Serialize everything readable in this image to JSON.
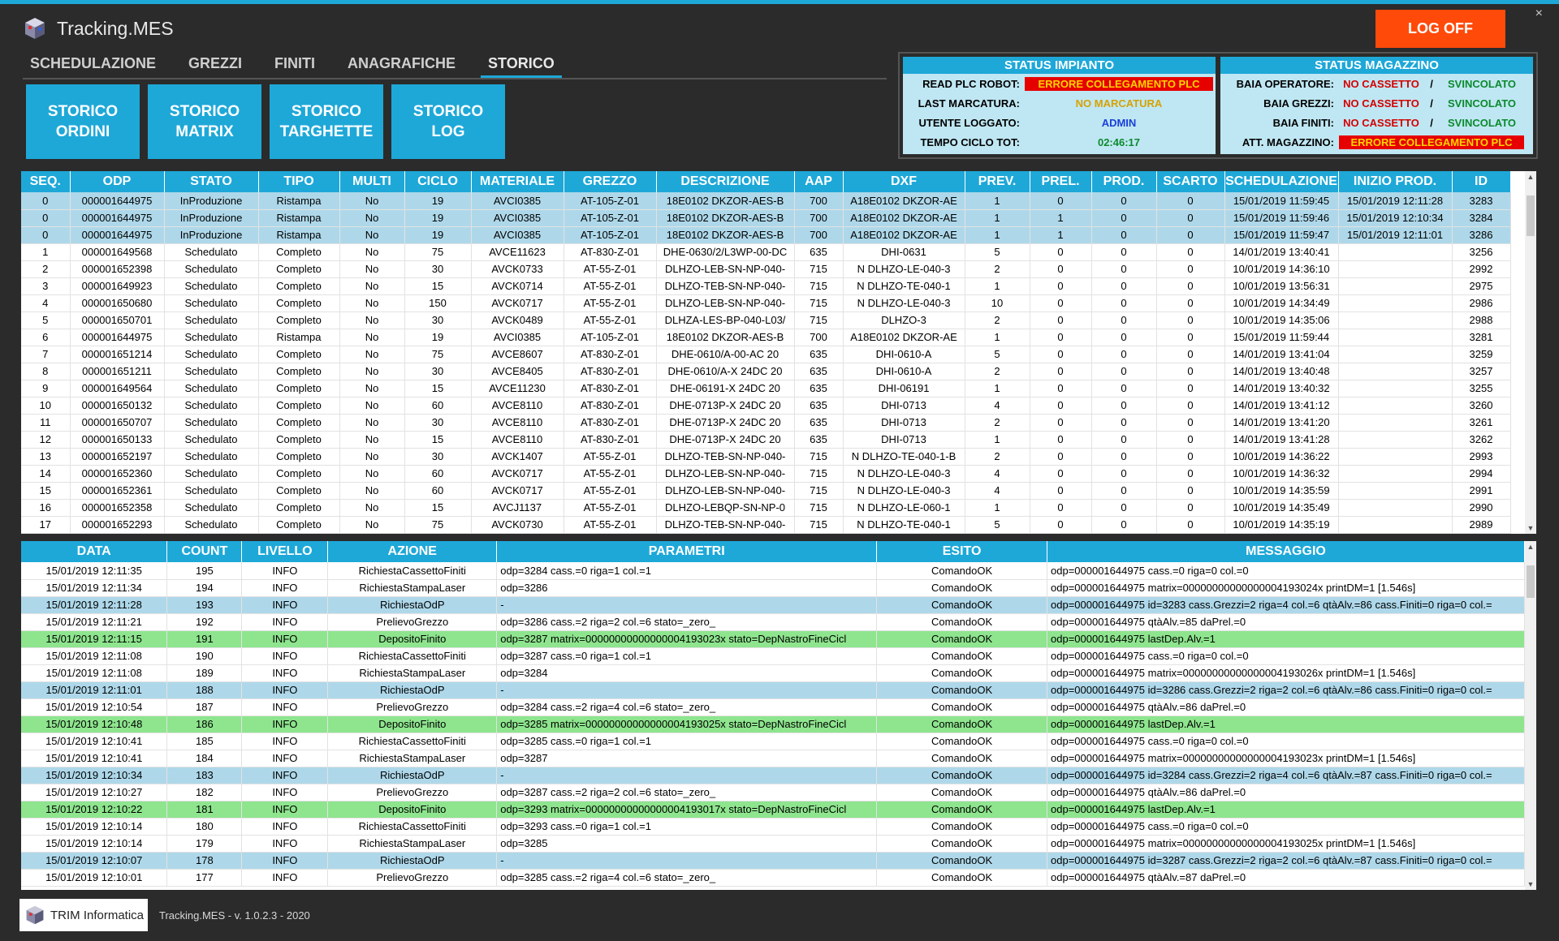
{
  "app": {
    "title": "Tracking.MES",
    "close_glyph": "×",
    "logoff_label": "LOG OFF"
  },
  "menu": [
    "SCHEDULAZIONE",
    "GREZZI",
    "FINITI",
    "ANAGRAFICHE",
    "STORICO"
  ],
  "menu_active": "STORICO",
  "subbuttons": [
    {
      "line1": "STORICO",
      "line2": "ORDINI"
    },
    {
      "line1": "STORICO",
      "line2": "MATRIX"
    },
    {
      "line1": "STORICO",
      "line2": "TARGHETTE"
    },
    {
      "line1": "STORICO",
      "line2": "LOG"
    }
  ],
  "status_impianto": {
    "title": "STATUS IMPIANTO",
    "rows": [
      {
        "label": "READ PLC ROBOT:",
        "value": "ERRORE COLLEGAMENTO PLC",
        "style": "err"
      },
      {
        "label": "LAST MARCATURA:",
        "value": "NO MARCATURA",
        "style": "warn"
      },
      {
        "label": "UTENTE LOGGATO:",
        "value": "ADMIN",
        "style": "blue"
      },
      {
        "label": "TEMPO CICLO TOT:",
        "value": "02:46:17",
        "style": "green"
      }
    ]
  },
  "status_magazzino": {
    "title": "STATUS MAGAZZINO",
    "rows": [
      {
        "label": "BAIA OPERATORE:",
        "left": "NO CASSETTO",
        "sep": "/",
        "right": "SVINCOLATO"
      },
      {
        "label": "BAIA GREZZI:",
        "left": "NO CASSETTO",
        "sep": "/",
        "right": "SVINCOLATO"
      },
      {
        "label": "BAIA FINITI:",
        "left": "NO CASSETTO",
        "sep": "/",
        "right": "SVINCOLATO"
      }
    ],
    "att_label": "ATT. MAGAZZINO:",
    "att_value": "ERRORE COLLEGAMENTO PLC"
  },
  "orders": {
    "columns": [
      "SEQ.",
      "ODP",
      "STATO",
      "TIPO",
      "MULTI",
      "CICLO",
      "MATERIALE",
      "GREZZO",
      "DESCRIZIONE",
      "AAP",
      "DXF",
      "PREV.",
      "PREL.",
      "PROD.",
      "SCARTO",
      "SCHEDULAZIONE",
      "INIZIO PROD.",
      "ID"
    ],
    "rows": [
      [
        "0",
        "000001644975",
        "InProduzione",
        "Ristampa",
        "No",
        "19",
        "AVCI0385",
        "AT-105-Z-01",
        "18E0102 DKZOR-AES-B",
        "700",
        "A18E0102 DKZOR-AE",
        "1",
        "0",
        "0",
        "0",
        "15/01/2019 11:59:45",
        "15/01/2019 12:11:28",
        "3283"
      ],
      [
        "0",
        "000001644975",
        "InProduzione",
        "Ristampa",
        "No",
        "19",
        "AVCI0385",
        "AT-105-Z-01",
        "18E0102 DKZOR-AES-B",
        "700",
        "A18E0102 DKZOR-AE",
        "1",
        "1",
        "0",
        "0",
        "15/01/2019 11:59:46",
        "15/01/2019 12:10:34",
        "3284"
      ],
      [
        "0",
        "000001644975",
        "InProduzione",
        "Ristampa",
        "No",
        "19",
        "AVCI0385",
        "AT-105-Z-01",
        "18E0102 DKZOR-AES-B",
        "700",
        "A18E0102 DKZOR-AE",
        "1",
        "1",
        "0",
        "0",
        "15/01/2019 11:59:47",
        "15/01/2019 12:11:01",
        "3286"
      ],
      [
        "1",
        "000001649568",
        "Schedulato",
        "Completo",
        "No",
        "75",
        "AVCE11623",
        "AT-830-Z-01",
        "DHE-0630/2/L3WP-00-DC",
        "635",
        "DHI-0631",
        "5",
        "0",
        "0",
        "0",
        "14/01/2019 13:40:41",
        "",
        "3256"
      ],
      [
        "2",
        "000001652398",
        "Schedulato",
        "Completo",
        "No",
        "30",
        "AVCK0733",
        "AT-55-Z-01",
        "DLHZO-LEB-SN-NP-040-",
        "715",
        "N DLHZO-LE-040-3",
        "2",
        "0",
        "0",
        "0",
        "10/01/2019 14:36:10",
        "",
        "2992"
      ],
      [
        "3",
        "000001649923",
        "Schedulato",
        "Completo",
        "No",
        "15",
        "AVCK0714",
        "AT-55-Z-01",
        "DLHZO-TEB-SN-NP-040-",
        "715",
        "N DLHZO-TE-040-1",
        "1",
        "0",
        "0",
        "0",
        "10/01/2019 13:56:31",
        "",
        "2975"
      ],
      [
        "4",
        "000001650680",
        "Schedulato",
        "Completo",
        "No",
        "150",
        "AVCK0717",
        "AT-55-Z-01",
        "DLHZO-LEB-SN-NP-040-",
        "715",
        "N DLHZO-LE-040-3",
        "10",
        "0",
        "0",
        "0",
        "10/01/2019 14:34:49",
        "",
        "2986"
      ],
      [
        "5",
        "000001650701",
        "Schedulato",
        "Completo",
        "No",
        "30",
        "AVCK0489",
        "AT-55-Z-01",
        "DLHZA-LES-BP-040-L03/",
        "715",
        "DLHZO-3",
        "2",
        "0",
        "0",
        "0",
        "10/01/2019 14:35:06",
        "",
        "2988"
      ],
      [
        "6",
        "000001644975",
        "Schedulato",
        "Ristampa",
        "No",
        "19",
        "AVCI0385",
        "AT-105-Z-01",
        "18E0102 DKZOR-AES-B",
        "700",
        "A18E0102 DKZOR-AE",
        "1",
        "0",
        "0",
        "0",
        "15/01/2019 11:59:44",
        "",
        "3281"
      ],
      [
        "7",
        "000001651214",
        "Schedulato",
        "Completo",
        "No",
        "75",
        "AVCE8607",
        "AT-830-Z-01",
        "DHE-0610/A-00-AC 20",
        "635",
        "DHI-0610-A",
        "5",
        "0",
        "0",
        "0",
        "14/01/2019 13:41:04",
        "",
        "3259"
      ],
      [
        "8",
        "000001651211",
        "Schedulato",
        "Completo",
        "No",
        "30",
        "AVCE8405",
        "AT-830-Z-01",
        "DHE-0610/A-X 24DC 20",
        "635",
        "DHI-0610-A",
        "2",
        "0",
        "0",
        "0",
        "14/01/2019 13:40:48",
        "",
        "3257"
      ],
      [
        "9",
        "000001649564",
        "Schedulato",
        "Completo",
        "No",
        "15",
        "AVCE11230",
        "AT-830-Z-01",
        "DHE-06191-X 24DC 20",
        "635",
        "DHI-06191",
        "1",
        "0",
        "0",
        "0",
        "14/01/2019 13:40:32",
        "",
        "3255"
      ],
      [
        "10",
        "000001650132",
        "Schedulato",
        "Completo",
        "No",
        "60",
        "AVCE8110",
        "AT-830-Z-01",
        "DHE-0713P-X 24DC 20",
        "635",
        "DHI-0713",
        "4",
        "0",
        "0",
        "0",
        "14/01/2019 13:41:12",
        "",
        "3260"
      ],
      [
        "11",
        "000001650707",
        "Schedulato",
        "Completo",
        "No",
        "30",
        "AVCE8110",
        "AT-830-Z-01",
        "DHE-0713P-X 24DC 20",
        "635",
        "DHI-0713",
        "2",
        "0",
        "0",
        "0",
        "14/01/2019 13:41:20",
        "",
        "3261"
      ],
      [
        "12",
        "000001650133",
        "Schedulato",
        "Completo",
        "No",
        "15",
        "AVCE8110",
        "AT-830-Z-01",
        "DHE-0713P-X 24DC 20",
        "635",
        "DHI-0713",
        "1",
        "0",
        "0",
        "0",
        "14/01/2019 13:41:28",
        "",
        "3262"
      ],
      [
        "13",
        "000001652197",
        "Schedulato",
        "Completo",
        "No",
        "30",
        "AVCK1407",
        "AT-55-Z-01",
        "DLHZO-TEB-SN-NP-040-",
        "715",
        "N DLHZO-TE-040-1-B",
        "2",
        "0",
        "0",
        "0",
        "10/01/2019 14:36:22",
        "",
        "2993"
      ],
      [
        "14",
        "000001652360",
        "Schedulato",
        "Completo",
        "No",
        "60",
        "AVCK0717",
        "AT-55-Z-01",
        "DLHZO-LEB-SN-NP-040-",
        "715",
        "N DLHZO-LE-040-3",
        "4",
        "0",
        "0",
        "0",
        "10/01/2019 14:36:32",
        "",
        "2994"
      ],
      [
        "15",
        "000001652361",
        "Schedulato",
        "Completo",
        "No",
        "60",
        "AVCK0717",
        "AT-55-Z-01",
        "DLHZO-LEB-SN-NP-040-",
        "715",
        "N DLHZO-LE-040-3",
        "4",
        "0",
        "0",
        "0",
        "10/01/2019 14:35:59",
        "",
        "2991"
      ],
      [
        "16",
        "000001652358",
        "Schedulato",
        "Completo",
        "No",
        "15",
        "AVCJ1137",
        "AT-55-Z-01",
        "DLHZO-LEBQP-SN-NP-0",
        "715",
        "N DLHZO-LE-060-1",
        "1",
        "0",
        "0",
        "0",
        "10/01/2019 14:35:49",
        "",
        "2990"
      ],
      [
        "17",
        "000001652293",
        "Schedulato",
        "Completo",
        "No",
        "75",
        "AVCK0730",
        "AT-55-Z-01",
        "DLHZO-TEB-SN-NP-040-",
        "715",
        "N DLHZO-TE-040-1",
        "5",
        "0",
        "0",
        "0",
        "10/01/2019 14:35:19",
        "",
        "2989"
      ]
    ]
  },
  "log": {
    "columns": [
      "DATA",
      "COUNT",
      "LIVELLO",
      "AZIONE",
      "PARAMETRI",
      "ESITO",
      "MESSAGGIO"
    ],
    "rows": [
      {
        "c": [
          "15/01/2019 12:11:35",
          "195",
          "INFO",
          "RichiestaCassettoFiniti",
          "odp=3284 cass.=0 riga=1 col.=1",
          "ComandoOK",
          "odp=000001644975 cass.=0 riga=0 col.=0"
        ],
        "k": "w"
      },
      {
        "c": [
          "15/01/2019 12:11:34",
          "194",
          "INFO",
          "RichiestaStampaLaser",
          "odp=3286",
          "ComandoOK",
          "odp=000001644975 matrix=00000000000000004193024x printDM=1 [1.546s]"
        ],
        "k": "w"
      },
      {
        "c": [
          "15/01/2019 12:11:28",
          "193",
          "INFO",
          "RichiestaOdP",
          "-",
          "ComandoOK",
          "odp=000001644975 id=3283 cass.Grezzi=2 riga=4 col.=6 qtàAlv.=86 cass.Finiti=0 riga=0 col.="
        ],
        "k": "b"
      },
      {
        "c": [
          "15/01/2019 12:11:21",
          "192",
          "INFO",
          "PrelievoGrezzo",
          "odp=3286 cass.=2 riga=2 col.=6 stato=_zero_",
          "ComandoOK",
          "odp=000001644975 qtàAlv.=85 daPrel.=0"
        ],
        "k": "w"
      },
      {
        "c": [
          "15/01/2019 12:11:15",
          "191",
          "INFO",
          "DepositoFinito",
          "odp=3287  matrix=00000000000000004193023x  stato=DepNastroFineCicl",
          "ComandoOK",
          "odp=000001644975 lastDep.Alv.=1"
        ],
        "k": "g"
      },
      {
        "c": [
          "15/01/2019 12:11:08",
          "190",
          "INFO",
          "RichiestaCassettoFiniti",
          "odp=3287 cass.=0 riga=1 col.=1",
          "ComandoOK",
          "odp=000001644975 cass.=0 riga=0 col.=0"
        ],
        "k": "w"
      },
      {
        "c": [
          "15/01/2019 12:11:08",
          "189",
          "INFO",
          "RichiestaStampaLaser",
          "odp=3284",
          "ComandoOK",
          "odp=000001644975 matrix=00000000000000004193026x printDM=1 [1.546s]"
        ],
        "k": "w"
      },
      {
        "c": [
          "15/01/2019 12:11:01",
          "188",
          "INFO",
          "RichiestaOdP",
          "-",
          "ComandoOK",
          "odp=000001644975 id=3286 cass.Grezzi=2 riga=2 col.=6 qtàAlv.=86 cass.Finiti=0 riga=0 col.="
        ],
        "k": "b"
      },
      {
        "c": [
          "15/01/2019 12:10:54",
          "187",
          "INFO",
          "PrelievoGrezzo",
          "odp=3284 cass.=2 riga=4 col.=6 stato=_zero_",
          "ComandoOK",
          "odp=000001644975 qtàAlv.=86 daPrel.=0"
        ],
        "k": "w"
      },
      {
        "c": [
          "15/01/2019 12:10:48",
          "186",
          "INFO",
          "DepositoFinito",
          "odp=3285  matrix=00000000000000004193025x  stato=DepNastroFineCicl",
          "ComandoOK",
          "odp=000001644975 lastDep.Alv.=1"
        ],
        "k": "g"
      },
      {
        "c": [
          "15/01/2019 12:10:41",
          "185",
          "INFO",
          "RichiestaCassettoFiniti",
          "odp=3285 cass.=0 riga=1 col.=1",
          "ComandoOK",
          "odp=000001644975 cass.=0 riga=0 col.=0"
        ],
        "k": "w"
      },
      {
        "c": [
          "15/01/2019 12:10:41",
          "184",
          "INFO",
          "RichiestaStampaLaser",
          "odp=3287",
          "ComandoOK",
          "odp=000001644975 matrix=00000000000000004193023x printDM=1 [1.546s]"
        ],
        "k": "w"
      },
      {
        "c": [
          "15/01/2019 12:10:34",
          "183",
          "INFO",
          "RichiestaOdP",
          "-",
          "ComandoOK",
          "odp=000001644975 id=3284 cass.Grezzi=2 riga=4 col.=6 qtàAlv.=87 cass.Finiti=0 riga=0 col.="
        ],
        "k": "b"
      },
      {
        "c": [
          "15/01/2019 12:10:27",
          "182",
          "INFO",
          "PrelievoGrezzo",
          "odp=3287 cass.=2 riga=2 col.=6 stato=_zero_",
          "ComandoOK",
          "odp=000001644975 qtàAlv.=86 daPrel.=0"
        ],
        "k": "w"
      },
      {
        "c": [
          "15/01/2019 12:10:22",
          "181",
          "INFO",
          "DepositoFinito",
          "odp=3293  matrix=00000000000000004193017x  stato=DepNastroFineCicl",
          "ComandoOK",
          "odp=000001644975 lastDep.Alv.=1"
        ],
        "k": "g"
      },
      {
        "c": [
          "15/01/2019 12:10:14",
          "180",
          "INFO",
          "RichiestaCassettoFiniti",
          "odp=3293 cass.=0 riga=1 col.=1",
          "ComandoOK",
          "odp=000001644975 cass.=0 riga=0 col.=0"
        ],
        "k": "w"
      },
      {
        "c": [
          "15/01/2019 12:10:14",
          "179",
          "INFO",
          "RichiestaStampaLaser",
          "odp=3285",
          "ComandoOK",
          "odp=000001644975 matrix=00000000000000004193025x printDM=1 [1.546s]"
        ],
        "k": "w"
      },
      {
        "c": [
          "15/01/2019 12:10:07",
          "178",
          "INFO",
          "RichiestaOdP",
          "-",
          "ComandoOK",
          "odp=000001644975 id=3287 cass.Grezzi=2 riga=2 col.=6 qtàAlv.=87 cass.Finiti=0 riga=0 col.="
        ],
        "k": "b"
      },
      {
        "c": [
          "15/01/2019 12:10:01",
          "177",
          "INFO",
          "PrelievoGrezzo",
          "odp=3285 cass.=2 riga=4 col.=6 stato=_zero_",
          "ComandoOK",
          "odp=000001644975 qtàAlv.=87 daPrel.=0"
        ],
        "k": "w"
      }
    ]
  },
  "footer": {
    "logo_text": "TRIM Informatica",
    "app_name": "Tracking.MES",
    "sep1": "-",
    "version": "v. 1.0.2.3",
    "sep2": "-",
    "year": "2020"
  },
  "colors": {
    "accent": "#1ea8d8",
    "logoff": "#ff4a0a",
    "row_production": "#aed8ea",
    "row_green": "#8ee58e",
    "error_bg": "#e60000",
    "error_text": "#ffd400"
  }
}
